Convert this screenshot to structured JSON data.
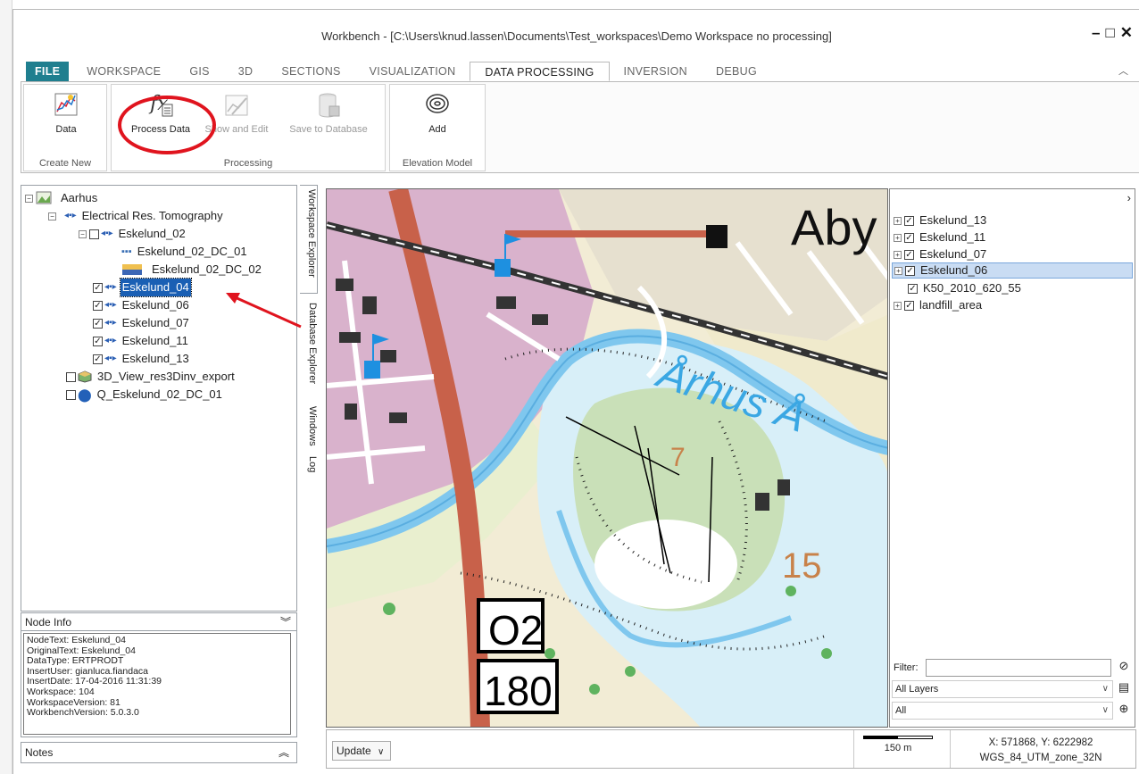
{
  "window": {
    "title": "Workbench - [C:\\Users\\knud.lassen\\Documents\\Test_workspaces\\Demo Workspace no processing]",
    "controls": [
      "–",
      "□",
      "✕"
    ]
  },
  "ribbon": {
    "tabs": [
      "FILE",
      "WORKSPACE",
      "GIS",
      "3D",
      "SECTIONS",
      "VISUALIZATION",
      "DATA PROCESSING",
      "INVERSION",
      "DEBUG"
    ],
    "active_tab": "DATA PROCESSING",
    "groups": {
      "create_new": {
        "label": "Create New",
        "data_button": "Data"
      },
      "processing": {
        "label": "Processing",
        "process_button": "Process Data",
        "show_edit_button": "Show and Edit",
        "save_db_button": "Save to Database"
      },
      "elevation": {
        "label": "Elevation Model",
        "add_button": "Add"
      }
    }
  },
  "tree": {
    "root": "Aarhus",
    "ert": "Electrical Res. Tomography",
    "eskelund_02": "Eskelund_02",
    "dc01": "Eskelund_02_DC_01",
    "dc02": "Eskelund_02_DC_02",
    "items": [
      "Eskelund_04",
      "Eskelund_06",
      "Eskelund_07",
      "Eskelund_11",
      "Eskelund_13"
    ],
    "selected": "Eskelund_04",
    "view3d": "3D_View_res3Dinv_export",
    "q_item": "Q_Eskelund_02_DC_01"
  },
  "side_tabs": [
    "Workspace Explorer",
    "Database Explorer",
    "Windows",
    "Log"
  ],
  "node_info": {
    "header": "Node Info",
    "lines": [
      "NodeText:  Eskelund_04",
      "OriginalText:  Eskelund_04",
      "DataType:  ERTPRODT",
      "InsertUser:  gianluca.fiandaca",
      "InsertDate:  17-04-2016 11:31:39",
      "Workspace:  104",
      "WorkspaceVersion:  81",
      "WorkbenchVersion:  5.0.3.0"
    ]
  },
  "notes": {
    "label": "Notes"
  },
  "map": {
    "labels": {
      "aby": "Aby",
      "river": "Århus Å",
      "n15": "15",
      "n7": "7",
      "road_o2": "O2",
      "road_180": "180"
    }
  },
  "layers": {
    "items": [
      "Eskelund_13",
      "Eskelund_11",
      "Eskelund_07",
      "Eskelund_06",
      "K50_2010_620_55",
      "landfill_area"
    ],
    "selected": "Eskelund_06",
    "filter_label": "Filter:",
    "select_layers": "All Layers",
    "select_all": "All"
  },
  "status": {
    "update": "Update",
    "scale_label": "150 m",
    "coords": "X: 571868, Y: 6222982",
    "crs": "WGS_84_UTM_zone_32N"
  },
  "colors": {
    "file_tab": "#1f7f8f",
    "selection": "#1a5fb4",
    "highlight_circle": "#e0141e",
    "map_water": "#7fc7ee",
    "map_road": "#c8614a",
    "map_urban": "#d9b2cc"
  }
}
